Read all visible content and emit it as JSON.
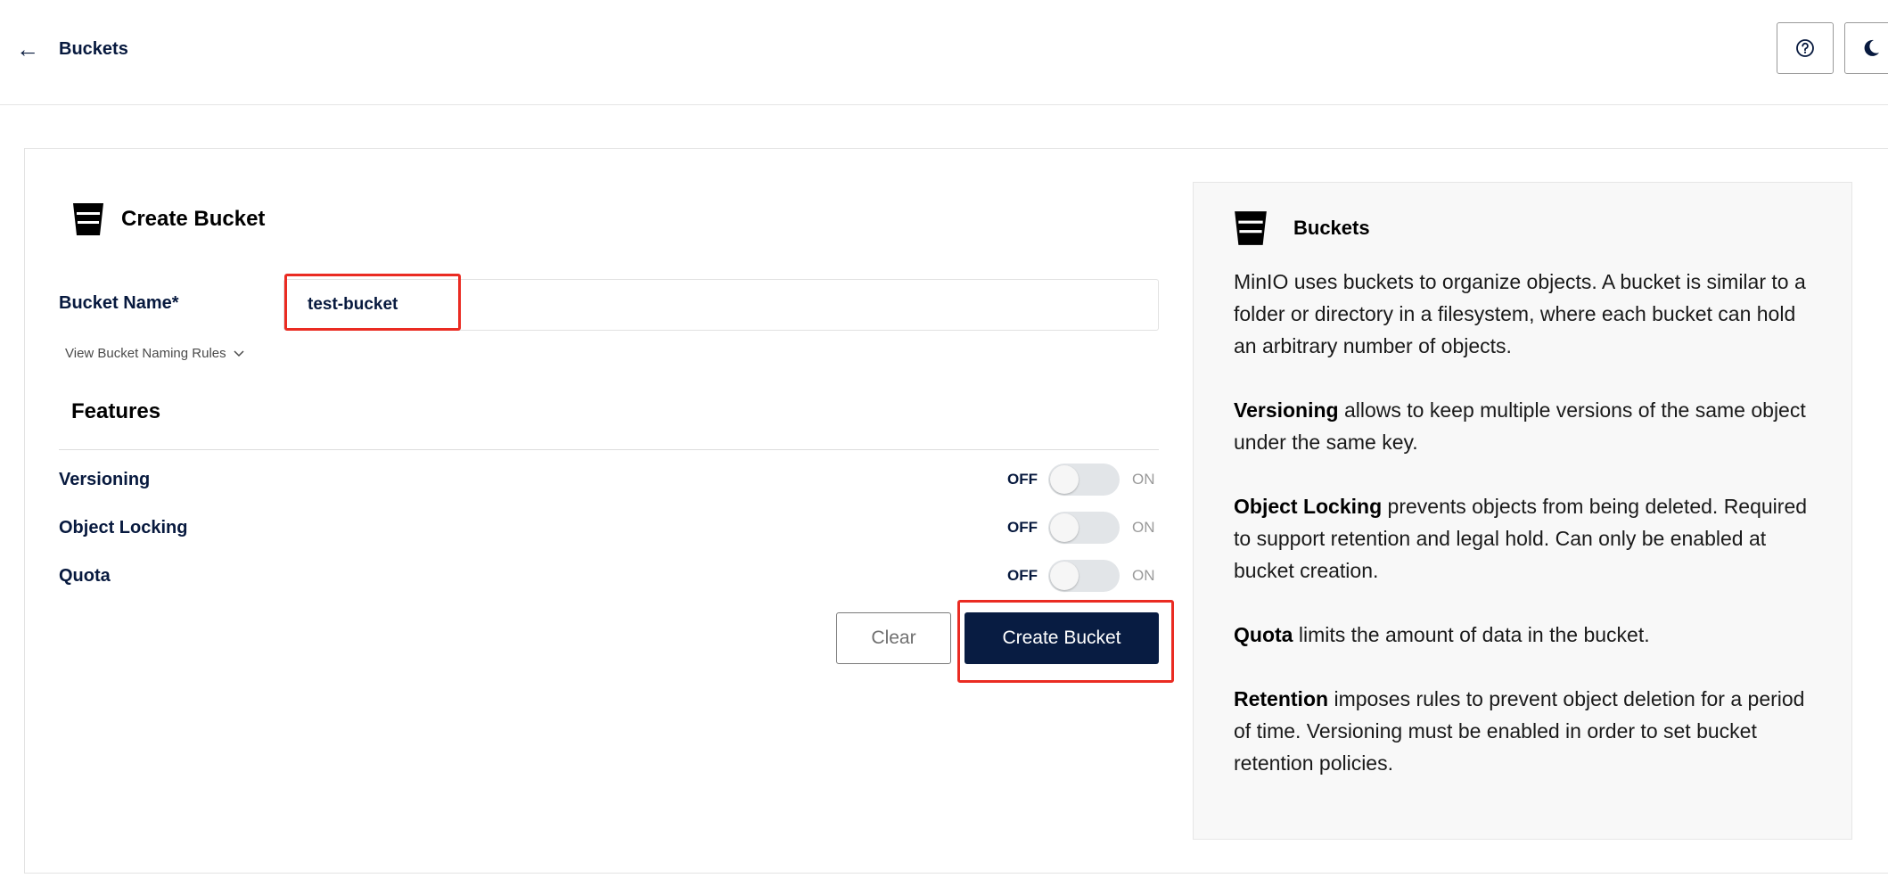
{
  "header": {
    "back_label": "Buckets",
    "help_icon": "help-circle-icon",
    "theme_icon": "moon-icon"
  },
  "form": {
    "title": "Create Bucket",
    "bucket_name_label": "Bucket Name*",
    "bucket_name_value": "test-bucket",
    "naming_rules_link": "View Bucket Naming Rules",
    "features_title": "Features",
    "features": [
      {
        "name": "Versioning",
        "off_label": "OFF",
        "on_label": "ON",
        "state": "off"
      },
      {
        "name": "Object Locking",
        "off_label": "OFF",
        "on_label": "ON",
        "state": "off"
      },
      {
        "name": "Quota",
        "off_label": "OFF",
        "on_label": "ON",
        "state": "off"
      }
    ],
    "clear_label": "Clear",
    "create_label": "Create Bucket"
  },
  "help": {
    "title": "Buckets",
    "intro": "MinIO uses buckets to organize objects. A bucket is similar to a folder or directory in a filesystem, where each bucket can hold an arbitrary number of objects.",
    "items": [
      {
        "term": "Versioning",
        "text": " allows to keep multiple versions of the same object under the same key."
      },
      {
        "term": "Object Locking",
        "text": " prevents objects from being deleted. Required to support retention and legal hold. Can only be enabled at bucket creation."
      },
      {
        "term": "Quota",
        "text": " limits the amount of data in the bucket."
      },
      {
        "term": "Retention",
        "text": " imposes rules to prevent object deletion for a period of time. Versioning must be enabled in order to set bucket retention policies."
      }
    ]
  },
  "colors": {
    "primary": "#081c42",
    "highlight": "#ea2b22",
    "text": "#07193e"
  }
}
